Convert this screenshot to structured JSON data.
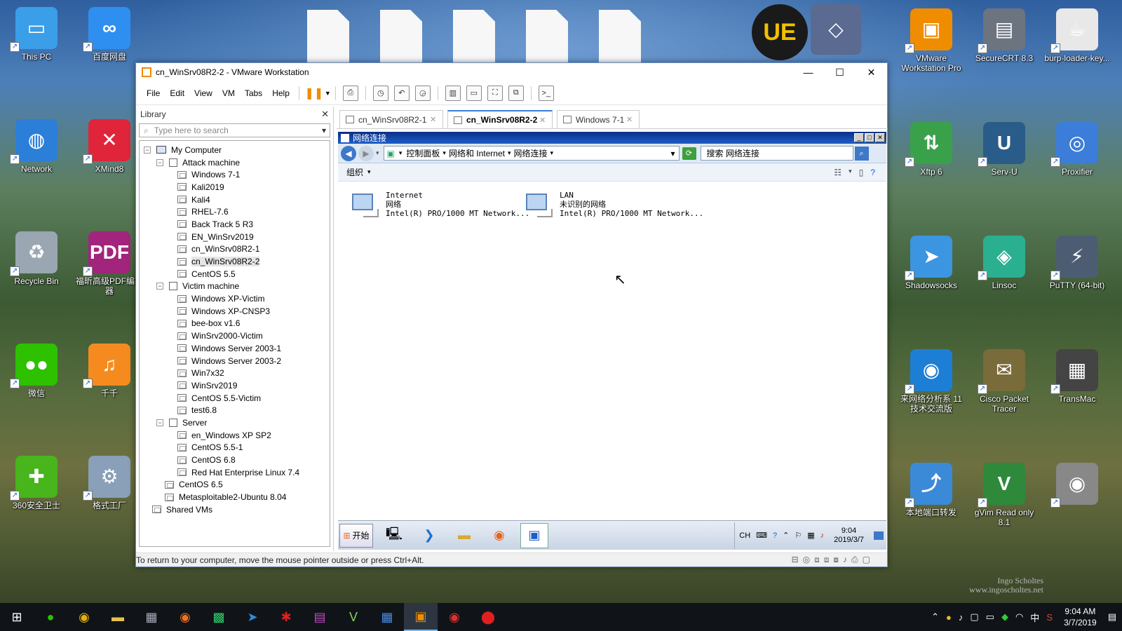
{
  "desktop": {
    "left_icons": [
      {
        "label": "This PC",
        "glyph": "▭",
        "color": "#3a9ee8"
      },
      {
        "label": "百度网盘",
        "glyph": "∞",
        "color": "#2f8ff0"
      },
      {
        "label": "Network",
        "glyph": "◍",
        "color": "#2c7fd8"
      },
      {
        "label": "XMind8",
        "glyph": "✕",
        "color": "#e0243a"
      },
      {
        "label": "Recycle Bin",
        "glyph": "♻",
        "color": "#9aa6b2"
      },
      {
        "label": "福昕高级PDF编辑器",
        "glyph": "PDF",
        "color": "#a3247c"
      },
      {
        "label": "微信",
        "glyph": "●●",
        "color": "#2dc100"
      },
      {
        "label": "千千",
        "glyph": "♫",
        "color": "#f58b1f"
      },
      {
        "label": "360安全卫士",
        "glyph": "✚",
        "color": "#47b51b"
      },
      {
        "label": "格式工厂",
        "glyph": "⚙",
        "color": "#8aa0b8"
      }
    ],
    "right_icons": [
      {
        "label": "VMware Workstation Pro",
        "glyph": "▣",
        "color": "#f08c00"
      },
      {
        "label": "SecureCRT 8.3",
        "glyph": "▤",
        "color": "#6c7480"
      },
      {
        "label": "burp-loader-key...",
        "glyph": "☕",
        "color": "#e8e8e8"
      },
      {
        "label": "Xftp 6",
        "glyph": "⇅",
        "color": "#3aa14b"
      },
      {
        "label": "Serv-U",
        "glyph": "U",
        "color": "#2a5c8a"
      },
      {
        "label": "Proxifier",
        "glyph": "◎",
        "color": "#3b7dd8"
      },
      {
        "label": "Shadowsocks",
        "glyph": "➤",
        "color": "#3b95e0"
      },
      {
        "label": "Linsoc",
        "glyph": "◈",
        "color": "#2ab090"
      },
      {
        "label": "PuTTY (64-bit)",
        "glyph": "⚡",
        "color": "#4c5d73"
      },
      {
        "label": "来网络分析系 11 技术交流版",
        "glyph": "◉",
        "color": "#1d7ed6"
      },
      {
        "label": "Cisco Packet Tracer",
        "glyph": "✉",
        "color": "#7a6b3a"
      },
      {
        "label": "TransMac",
        "glyph": "▦",
        "color": "#444"
      },
      {
        "label": "本地端口转发",
        "glyph": "⤴",
        "color": "#3a8ad8"
      },
      {
        "label": "gVim Read only 8.1",
        "glyph": "V",
        "color": "#2e8a3a"
      },
      {
        "label": "",
        "glyph": "◉",
        "color": "#888"
      }
    ],
    "top_icons": [
      {
        "glyph": "UE",
        "color": "#c9a40c"
      },
      {
        "glyph": "◇",
        "color": "#5a6a90"
      }
    ]
  },
  "vmware": {
    "title": "cn_WinSrv08R2-2 - VMware Workstation",
    "menu": [
      "File",
      "Edit",
      "View",
      "VM",
      "Tabs",
      "Help"
    ],
    "library": {
      "title": "Library",
      "search_placeholder": "Type here to search",
      "tree": [
        {
          "label": "My Computer",
          "level": 0,
          "kind": "pc",
          "toggle": "−"
        },
        {
          "label": "Attack machine",
          "level": 1,
          "kind": "folder",
          "toggle": "−"
        },
        {
          "label": "Windows 7-1",
          "level": 2,
          "kind": "vm"
        },
        {
          "label": "Kali2019",
          "level": 2,
          "kind": "vm"
        },
        {
          "label": "Kali4",
          "level": 2,
          "kind": "vm"
        },
        {
          "label": "RHEL-7.6",
          "level": 2,
          "kind": "vm"
        },
        {
          "label": "Back Track 5 R3",
          "level": 2,
          "kind": "vm"
        },
        {
          "label": "EN_WinSrv2019",
          "level": 2,
          "kind": "vm"
        },
        {
          "label": "cn_WinSrv08R2-1",
          "level": 2,
          "kind": "vm"
        },
        {
          "label": "cn_WinSrv08R2-2",
          "level": 2,
          "kind": "vm",
          "selected": true
        },
        {
          "label": "CentOS 5.5",
          "level": 2,
          "kind": "vm"
        },
        {
          "label": "Victim machine",
          "level": 1,
          "kind": "folder",
          "toggle": "−"
        },
        {
          "label": "Windows XP-Victim",
          "level": 2,
          "kind": "vm"
        },
        {
          "label": "Windows XP-CNSP3",
          "level": 2,
          "kind": "vm"
        },
        {
          "label": "bee-box v1.6",
          "level": 2,
          "kind": "vm"
        },
        {
          "label": "WinSrv2000-Victim",
          "level": 2,
          "kind": "vm"
        },
        {
          "label": "Windows Server 2003-1",
          "level": 2,
          "kind": "vm"
        },
        {
          "label": "Windows Server 2003-2",
          "level": 2,
          "kind": "vm"
        },
        {
          "label": "Win7x32",
          "level": 2,
          "kind": "vm"
        },
        {
          "label": "WinSrv2019",
          "level": 2,
          "kind": "vm"
        },
        {
          "label": "CentOS 5.5-Victim",
          "level": 2,
          "kind": "vm"
        },
        {
          "label": "test6.8",
          "level": 2,
          "kind": "vm"
        },
        {
          "label": "Server",
          "level": 1,
          "kind": "folder",
          "toggle": "−"
        },
        {
          "label": "en_Windows XP SP2",
          "level": 2,
          "kind": "vm"
        },
        {
          "label": "CentOS 5.5-1",
          "level": 2,
          "kind": "vm"
        },
        {
          "label": "CentOS 6.8",
          "level": 2,
          "kind": "vm"
        },
        {
          "label": "Red Hat Enterprise Linux 7.4",
          "level": 2,
          "kind": "vm"
        },
        {
          "label": "CentOS 6.5",
          "level": 1,
          "kind": "vm"
        },
        {
          "label": "Metasploitable2-Ubuntu 8.04",
          "level": 1,
          "kind": "vm"
        },
        {
          "label": "Shared VMs",
          "level": 0,
          "kind": "vm"
        }
      ]
    },
    "tabs": [
      {
        "label": "cn_WinSrv08R2-1",
        "active": false
      },
      {
        "label": "cn_WinSrv08R2-2",
        "active": true
      },
      {
        "label": "Windows 7-1",
        "active": false
      }
    ],
    "status_text": "To return to your computer, move the mouse pointer outside or press Ctrl+Alt."
  },
  "guest": {
    "window_title": "网络连接",
    "breadcrumb": [
      "控制面板",
      "网络和 Internet",
      "网络连接"
    ],
    "search_placeholder": "搜索 网络连接",
    "organize_label": "组织",
    "connections": [
      {
        "name": "Internet",
        "status": "网络",
        "adapter": "Intel(R) PRO/1000 MT Network..."
      },
      {
        "name": "LAN",
        "status": "未识别的网络",
        "adapter": "Intel(R) PRO/1000 MT Network..."
      }
    ],
    "start_label": "开始",
    "tray_lang": "CH",
    "clock_time": "9:04",
    "clock_date": "2019/3/7"
  },
  "taskbar": {
    "lang": "中",
    "clock_time": "9:04 AM",
    "clock_date": "3/7/2019"
  },
  "watermark": {
    "line1": "Ingo Scholtes",
    "line2": "www.ingoscholtes.net"
  }
}
